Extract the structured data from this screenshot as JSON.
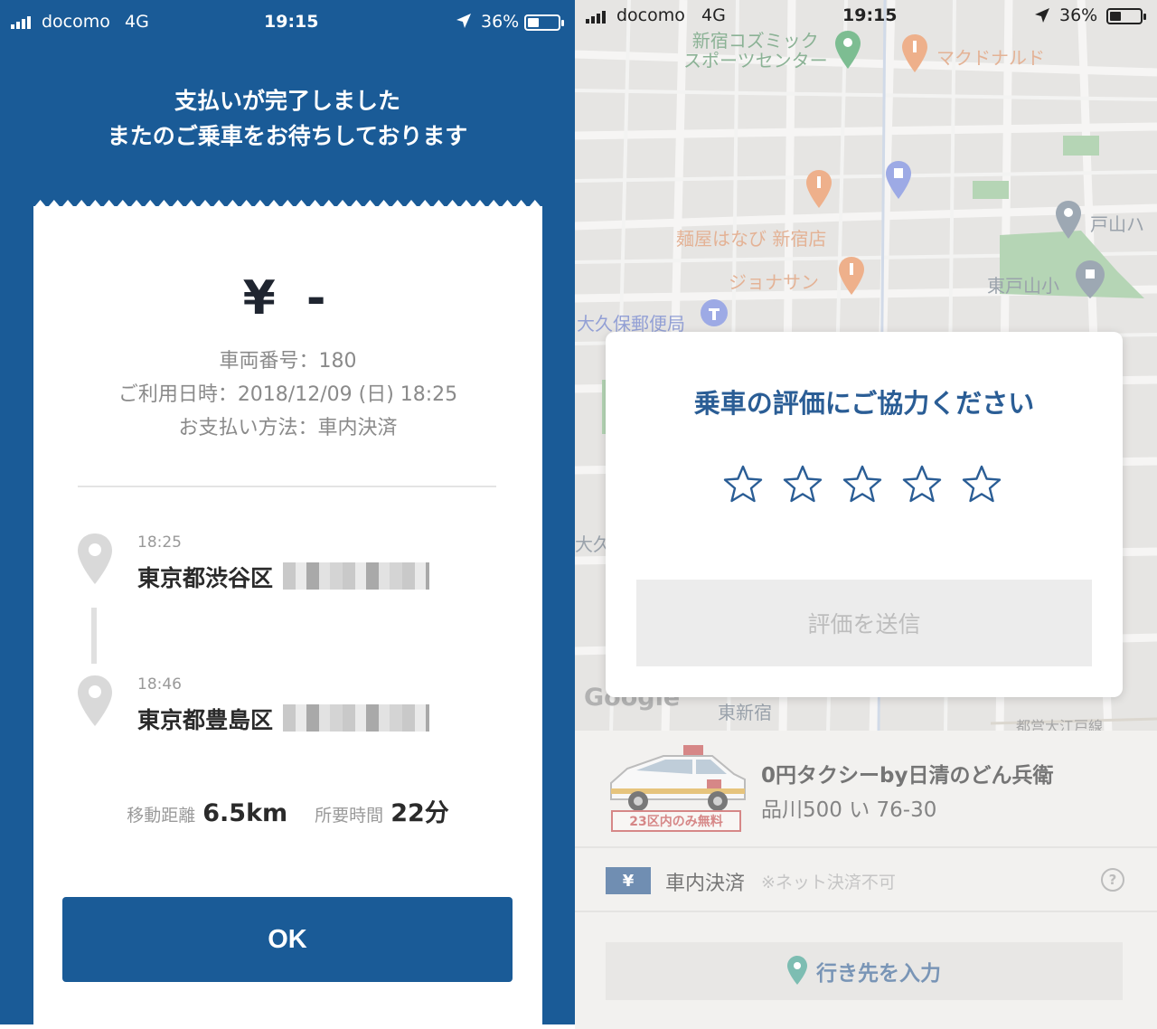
{
  "left_screen": {
    "status_bar": {
      "carrier": "docomo",
      "network": "4G",
      "time": "19:15",
      "battery": "36%"
    },
    "headline": {
      "line1": "支払いが完了しました",
      "line2": "またのご乗車をお待ちしております"
    },
    "receipt": {
      "price": "¥ -",
      "vehicle_number": "車両番号：180",
      "usage_datetime": "ご利用日時：2018/12/09 (日) 18:25",
      "payment_method": "お支払い方法：車内決済"
    },
    "route": {
      "pickup_time": "18:25",
      "pickup_address": "東京都渋谷区",
      "dropoff_time": "18:46",
      "dropoff_address": "東京都豊島区"
    },
    "stats": {
      "distance_label": "移動距離",
      "distance_value": "6.5km",
      "duration_label": "所要時間",
      "duration_value": "22分"
    },
    "ok_button": "OK"
  },
  "right_screen": {
    "status_bar": {
      "carrier": "docomo",
      "network": "4G",
      "time": "19:15",
      "battery": "36%"
    },
    "map_labels": {
      "sports_center_1": "新宿コズミック",
      "sports_center_2": "スポーツセンター",
      "mcdonalds": "マクドナルド",
      "ramen": "麺屋はなび 新宿店",
      "jonathan": "ジョナサン",
      "toyama": "戸山ハ",
      "higashi_toyama": "東戸山小",
      "post_office": "大久保郵便局",
      "okubo": "大久",
      "higashi_shinjuku": "東新宿",
      "toei_line": "都営大江戸線",
      "google": "Google"
    },
    "rating_dialog": {
      "title": "乗車の評価にご協力ください",
      "stars_total": 5,
      "stars_selected": 0,
      "submit_label": "評価を送信"
    },
    "taxi": {
      "name": "0円タクシーby日清のどん兵衛",
      "plate": "品川500 い 76-30",
      "badge": "23区内のみ無料"
    },
    "payment": {
      "yen_icon": "¥",
      "label": "車内決済",
      "note": "※ネット決済不可",
      "help": "?"
    },
    "destination_button": "行き先を入力"
  },
  "colors": {
    "brand_blue": "#1a5b97",
    "dialog_title_blue": "#2a5d95",
    "badge_red": "#c14a4a"
  },
  "icons": [
    "signal-icon",
    "location-arrow-icon",
    "battery-icon",
    "map-pin-icon",
    "star-outline-icon",
    "help-icon",
    "yen-icon",
    "taxi-icon"
  ]
}
